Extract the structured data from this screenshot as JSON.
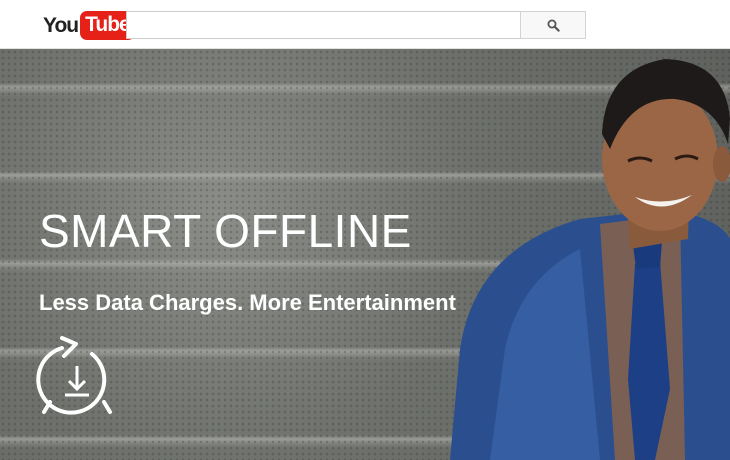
{
  "header": {
    "logo": {
      "part_you": "You",
      "part_tube": "Tube",
      "brand_color": "#e62117"
    },
    "search": {
      "placeholder": "",
      "button_icon": "search-icon"
    }
  },
  "hero": {
    "title": "SMART OFFLINE",
    "subtitle": "Less Data Charges. More Entertainment",
    "icon": "offline-download-icon"
  },
  "colors": {
    "text_on_hero": "#ffffff",
    "header_bg": "#ffffff"
  }
}
